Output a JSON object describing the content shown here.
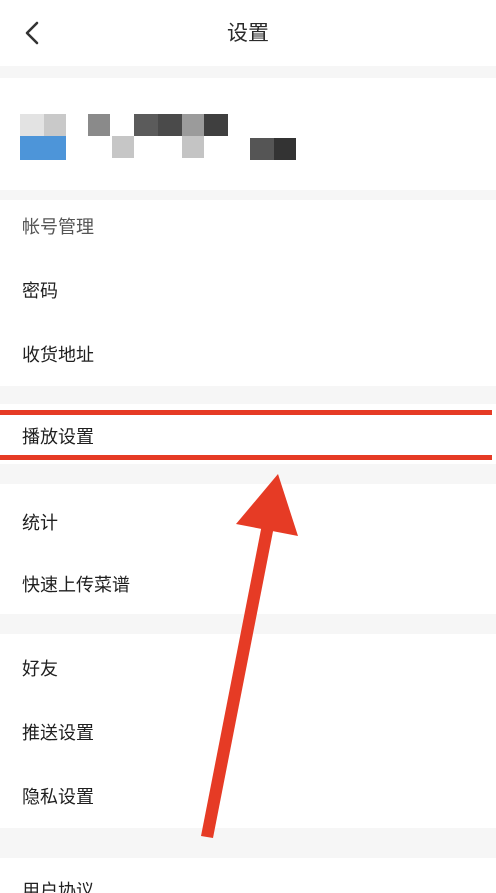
{
  "header": {
    "title": "设置"
  },
  "account": {
    "rows": [
      {
        "label": "帐号管理"
      },
      {
        "label": "密码"
      },
      {
        "label": "收货地址"
      }
    ]
  },
  "playback": {
    "rows": [
      {
        "label": "播放设置"
      }
    ]
  },
  "content": {
    "rows": [
      {
        "label": "统计"
      },
      {
        "label": "快速上传菜谱"
      }
    ]
  },
  "social": {
    "rows": [
      {
        "label": "好友"
      },
      {
        "label": "推送设置"
      },
      {
        "label": "隐私设置"
      }
    ]
  },
  "footer": {
    "partial_label": "用户协议"
  },
  "annotation": {
    "color": "#e63b25"
  },
  "icons": {
    "back": "chevron-left-icon"
  }
}
